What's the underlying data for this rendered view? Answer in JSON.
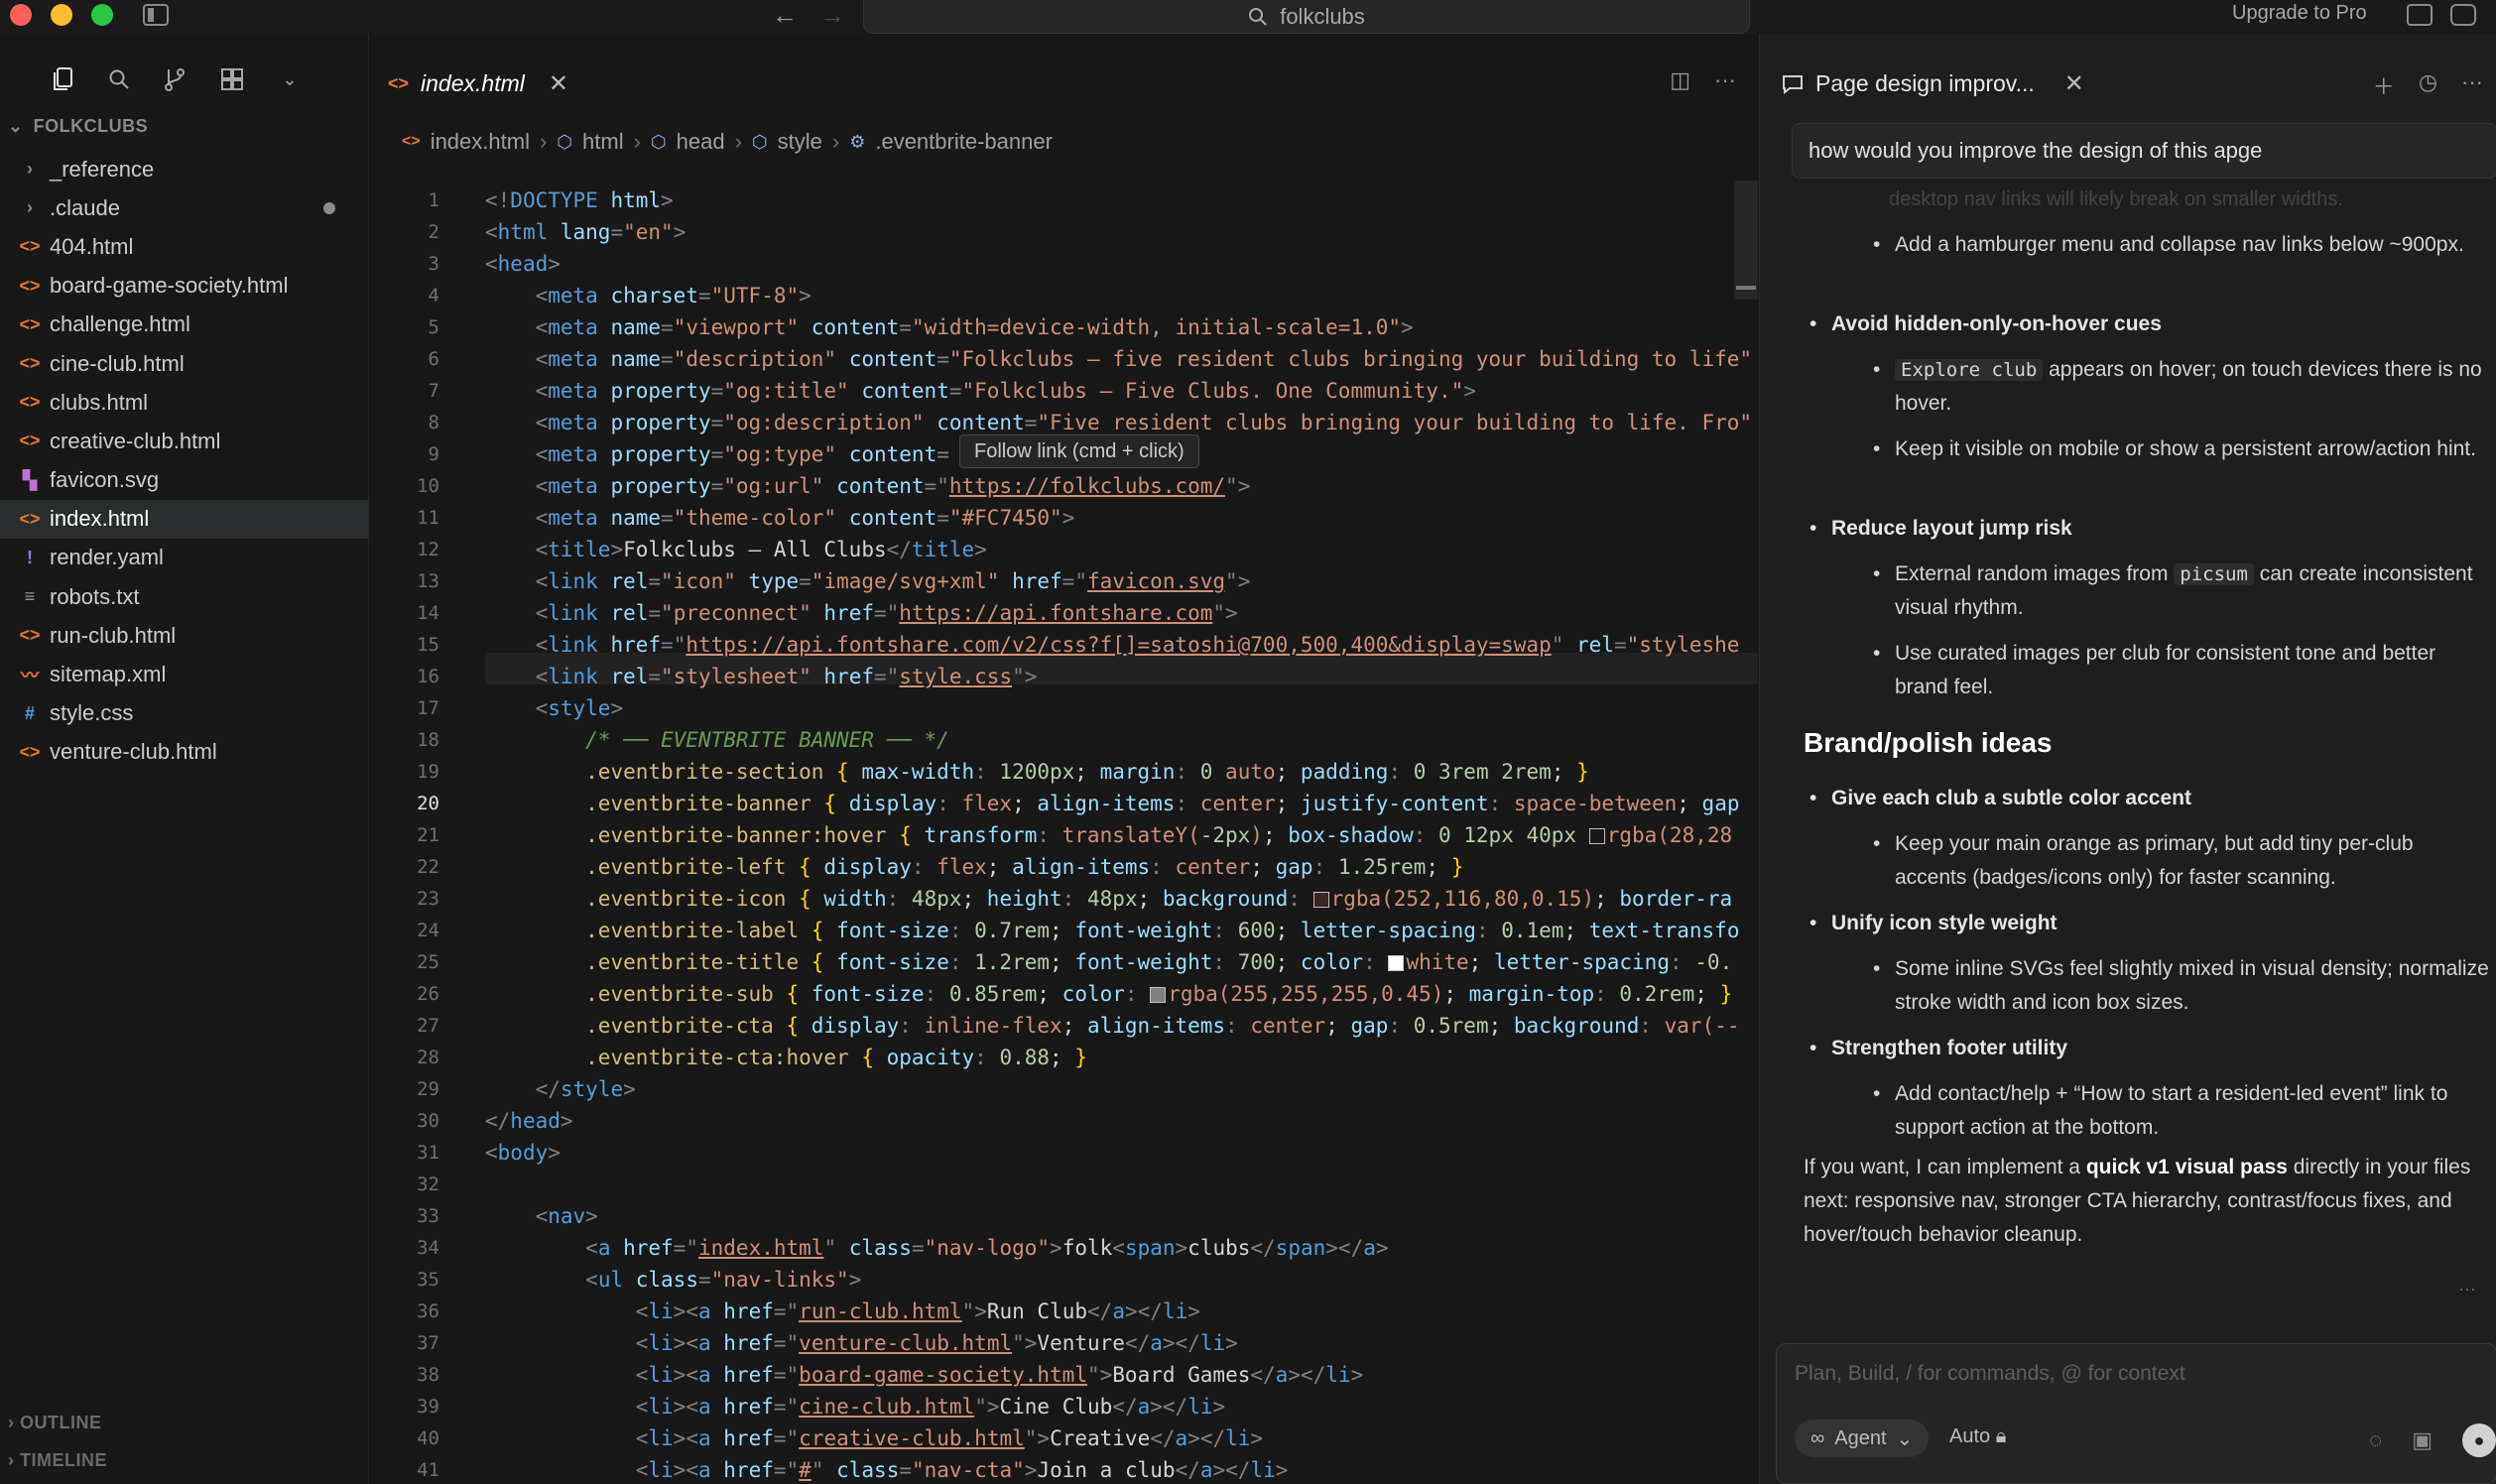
{
  "titlebar": {
    "search": "folkclubs",
    "upgrade": "Upgrade to Pro"
  },
  "explorer": {
    "section": "FOLKCLUBS",
    "files": [
      {
        "name": "_reference",
        "type": "folder"
      },
      {
        "name": ".claude",
        "type": "folder",
        "modified": true
      },
      {
        "name": "404.html",
        "type": "html"
      },
      {
        "name": "board-game-society.html",
        "type": "html"
      },
      {
        "name": "challenge.html",
        "type": "html"
      },
      {
        "name": "cine-club.html",
        "type": "html"
      },
      {
        "name": "clubs.html",
        "type": "html"
      },
      {
        "name": "creative-club.html",
        "type": "html"
      },
      {
        "name": "favicon.svg",
        "type": "svg"
      },
      {
        "name": "index.html",
        "type": "html",
        "selected": true
      },
      {
        "name": "render.yaml",
        "type": "yaml"
      },
      {
        "name": "robots.txt",
        "type": "txt"
      },
      {
        "name": "run-club.html",
        "type": "html"
      },
      {
        "name": "sitemap.xml",
        "type": "xml"
      },
      {
        "name": "style.css",
        "type": "css"
      },
      {
        "name": "venture-club.html",
        "type": "html"
      }
    ],
    "outline": "OUTLINE",
    "timeline": "TIMELINE"
  },
  "editor": {
    "tab": "index.html",
    "breadcrumb": [
      "index.html",
      "html",
      "head",
      "style",
      ".eventbrite-banner"
    ],
    "tooltip": "Follow link (cmd + click)",
    "current_line": 20,
    "first_line": 1
  },
  "chat": {
    "title": "Page design improv...",
    "query": "how would you improve the design of this apge",
    "faded_top": "desktop nav links will likely break on smaller widths.",
    "items": [
      {
        "level": 2,
        "text": "Add a hamburger menu and collapse nav links below ~900px."
      },
      {
        "level": 1,
        "text": "Avoid hidden-only-on-hover cues"
      },
      {
        "level": 2,
        "code": "Explore club",
        "text": " appears on hover; on touch devices there is no hover."
      },
      {
        "level": 2,
        "text": "Keep it visible on mobile or show a persistent arrow/action hint."
      },
      {
        "level": 1,
        "text": "Reduce layout jump risk"
      },
      {
        "level": 2,
        "pre": "External random images from ",
        "code": "picsum",
        "text": " can create inconsistent visual rhythm."
      },
      {
        "level": 2,
        "text": "Use curated images per club for consistent tone and better brand feel."
      }
    ],
    "heading": "Brand/polish ideas",
    "items2": [
      {
        "level": 1,
        "text": "Give each club a subtle color accent"
      },
      {
        "level": 2,
        "text": "Keep your main orange as primary, but add tiny per-club accents (badges/icons only) for faster scanning."
      },
      {
        "level": 1,
        "text": "Unify icon style weight"
      },
      {
        "level": 2,
        "text": "Some inline SVGs feel slightly mixed in visual density; normalize stroke width and icon box sizes."
      },
      {
        "level": 1,
        "text": "Strengthen footer utility"
      },
      {
        "level": 2,
        "text": "Add contact/help + “How to start a resident-led event” link to support action at the bottom."
      }
    ],
    "outro_pre": "If you want, I can implement a ",
    "outro_bold": "quick v1 visual pass",
    "outro_post": " directly in your files next: responsive nav, stronger CTA hierarchy, contrast/focus fixes, and hover/touch behavior cleanup.",
    "composer_placeholder": "Plan, Build, / for commands, @ for context",
    "agent_label": "Agent",
    "auto_label": "Auto"
  },
  "colors": {
    "accent_orange": "#e37933",
    "bg": "#181818",
    "panel": "#1e1e1e"
  }
}
